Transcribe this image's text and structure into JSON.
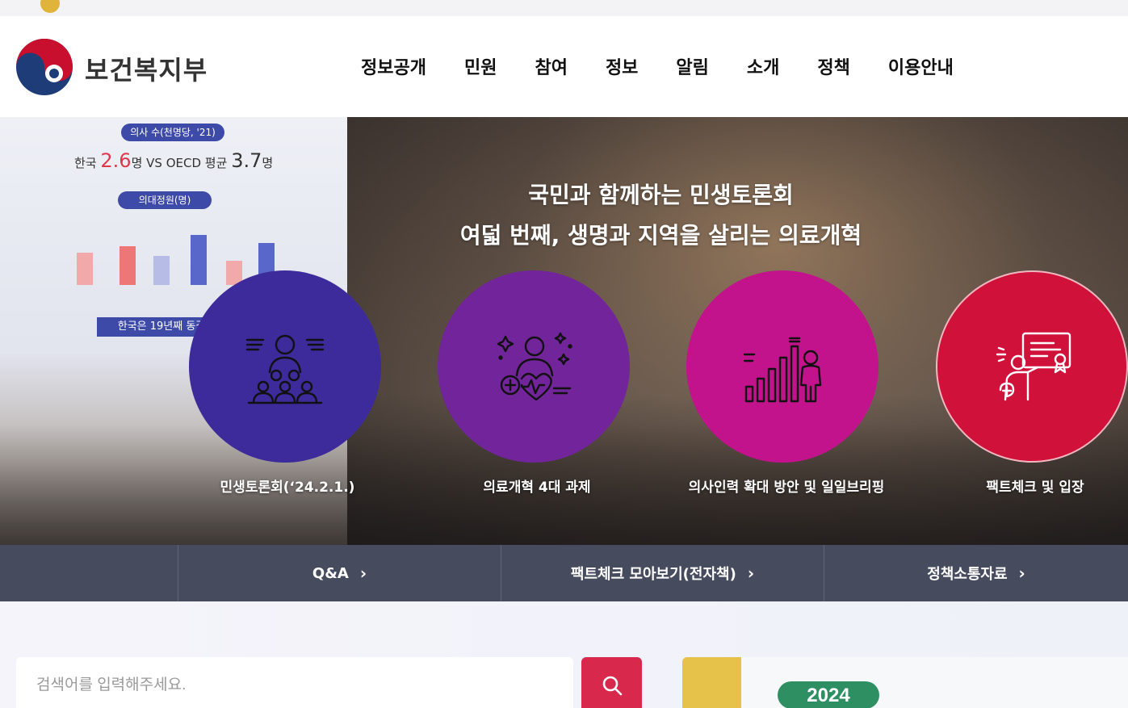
{
  "topbar": {
    "faded_text": "",
    "util_text": "",
    "signature": ""
  },
  "header": {
    "logo_text": "보건복지부",
    "nav": [
      "정보공개",
      "민원",
      "참여",
      "정보",
      "알림",
      "소개",
      "정책",
      "이용안내"
    ]
  },
  "hero": {
    "title_line1": "국민과 함께하는 민생토론회",
    "title_line2": "여덟 번째, 생명과 지역을 살리는 의료개혁",
    "items": [
      {
        "label": "민생토론회(‘24.2.1.)",
        "color": "#3d2b9c",
        "icon": "audience-icon"
      },
      {
        "label": "의료개혁 4대 과제",
        "color": "#72249a",
        "icon": "health-care-icon"
      },
      {
        "label": "의사인력 확대 방안 및 일일브리핑",
        "color": "#c3138c",
        "icon": "growth-chart-icon"
      },
      {
        "label": "팩트체크 및 입장",
        "color": "#d0123a",
        "icon": "presentation-icon"
      }
    ],
    "slide": {
      "tag1": "의사 수(천명당, '21)",
      "korea_label": "한국",
      "korea_value": "2.6",
      "unit": "명",
      "vs": "VS",
      "oecd_label": "OECD 평균",
      "oecd_value": "3.7",
      "tag2": "의대정원(명)",
      "caption": "한국은 19년째 동결"
    }
  },
  "quicklinks": [
    {
      "label": "Q&A"
    },
    {
      "label": "팩트체크 모아보기(전자책)"
    },
    {
      "label": "정책소통자료"
    }
  ],
  "search": {
    "placeholder": "검색어를 입력해주세요."
  },
  "banner": {
    "year": "2024"
  },
  "colors": {
    "quicklink_bg": "#474b5e",
    "search_button": "#d8284c"
  }
}
